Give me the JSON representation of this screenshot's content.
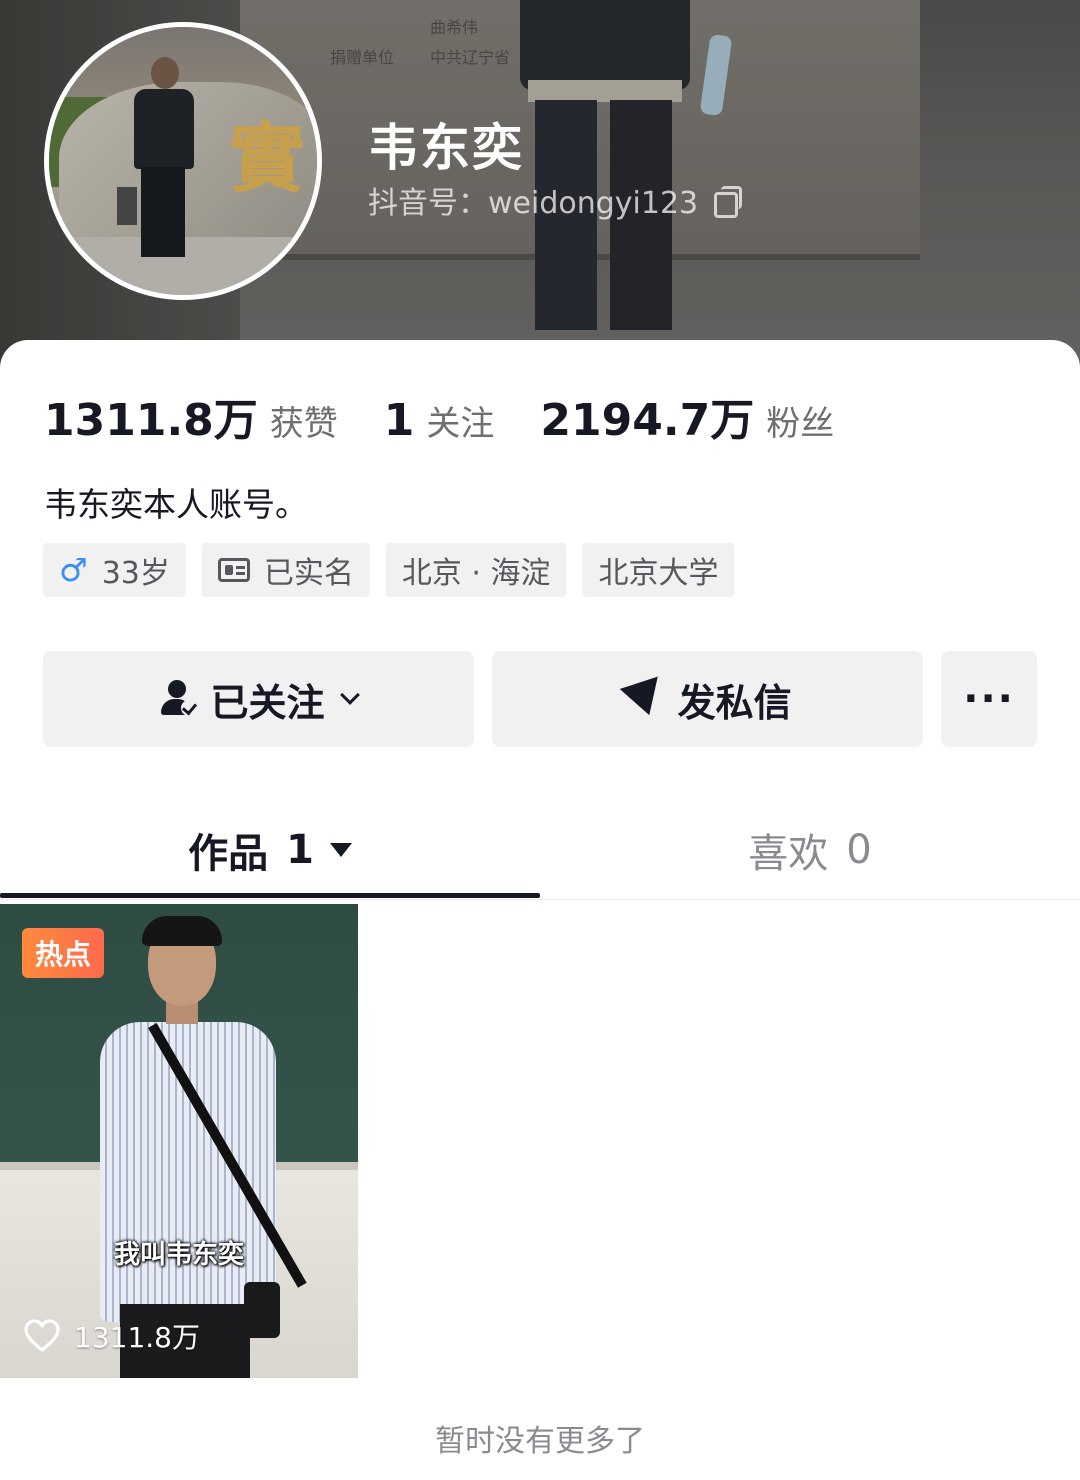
{
  "profile": {
    "name": "韦东奕",
    "douyin_id": "抖音号：weidongyi123"
  },
  "stats": [
    {
      "num": "1311.8万",
      "label": "获赞"
    },
    {
      "num": "1",
      "label": "关注"
    },
    {
      "num": "2194.7万",
      "label": "粉丝"
    }
  ],
  "bio": "韦东奕本人账号。",
  "tags": {
    "gender_icon": "♂",
    "age": "33岁",
    "verified": "已实名",
    "location": "北京 · 海淀",
    "school": "北京大学"
  },
  "actions": {
    "follow_label": "已关注",
    "message_label": "发私信",
    "more_label": "···"
  },
  "tabs": {
    "works_label": "作品",
    "works_count": "1",
    "likes_label": "喜欢",
    "likes_count": "0"
  },
  "video": {
    "badge": "热点",
    "caption": "我叫韦东奕",
    "likes": "1311.8万"
  },
  "footer": "暂时没有更多了",
  "cover_text": {
    "line1": "曲希伟",
    "line2": "捐赠单位",
    "line3": "中共辽宁省"
  },
  "avatar_glyph": "實",
  "colors": {
    "text_primary": "#161823",
    "text_secondary": "#6f6f73",
    "gender_blue": "#3a8ef2",
    "hot_badge": "#fe6a4c",
    "chip_bg": "#f1f1f2"
  }
}
